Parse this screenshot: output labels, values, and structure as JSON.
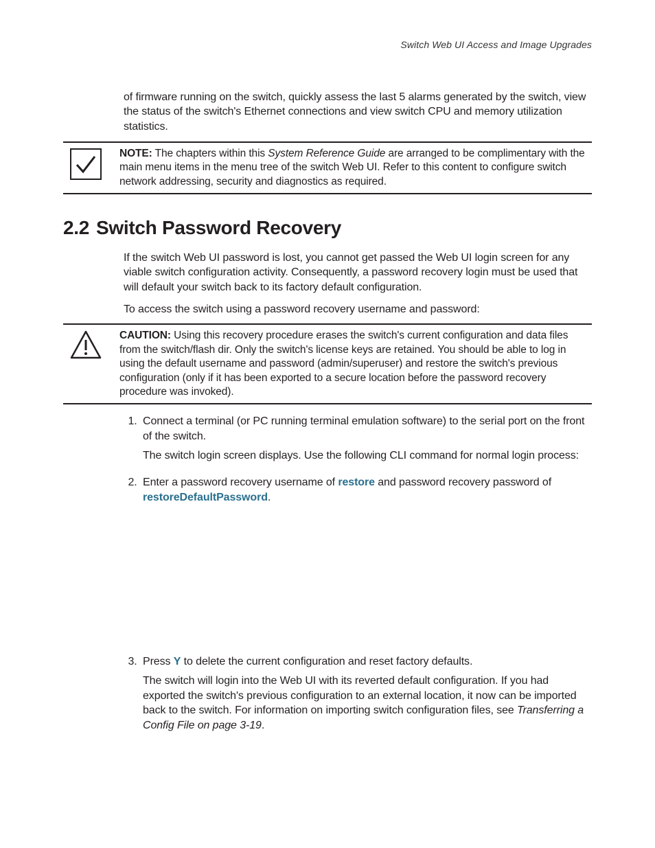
{
  "runningHead": "Switch Web UI Access and Image Upgrades",
  "introPara": "of firmware running on the switch, quickly assess the last 5 alarms generated by the switch, view the status of the switch's Ethernet connections and view switch CPU and memory utilization statistics.",
  "noteCallout": {
    "label": "NOTE:",
    "prefix": " The chapters within this ",
    "italic": "System Reference Guide",
    "suffix": " are arranged to be complimentary with the main menu items in the menu tree of the switch Web UI. Refer to this content to configure switch network addressing, security and diagnostics as required."
  },
  "section": {
    "num": "2.2",
    "title": "Switch Password Recovery",
    "p1": "If the switch Web UI password is lost, you cannot get passed the Web UI login screen for any viable switch configuration activity. Consequently, a password recovery login must be used that will default your switch back to its factory default configuration.",
    "p2": "To access the switch using a password recovery username and password:"
  },
  "cautionCallout": {
    "label": "CAUTION:",
    "text": " Using this recovery procedure erases the switch's current configuration and data files from the switch/flash dir. Only the switch's license keys are retained. You should be able to log in using the default username and password (admin/superuser) and restore the switch's previous configuration (only if it has been exported to a secure location before the password recovery procedure was invoked)."
  },
  "steps": {
    "s1a": "Connect a terminal (or PC running terminal emulation software) to the serial port on the front of the switch.",
    "s1b": "The switch login screen displays. Use the following CLI command for normal login process:",
    "s2_pre": "Enter a password recovery username of ",
    "s2_user": "restore",
    "s2_mid": " and password recovery password of ",
    "s2_pass": "restoreDefaultPassword",
    "s2_post": ".",
    "s3_pre": "Press ",
    "s3_key": "Y",
    "s3_post": " to delete the current configuration and reset factory defaults.",
    "s3b_pre": "The switch will login into the Web UI with its reverted default configuration. If you had exported the switch's previous configuration to an external location, it now can be imported back to the switch. For information on importing switch configuration files, see ",
    "s3b_italic": "Transferring a Config File on page 3-19",
    "s3b_post": "."
  }
}
